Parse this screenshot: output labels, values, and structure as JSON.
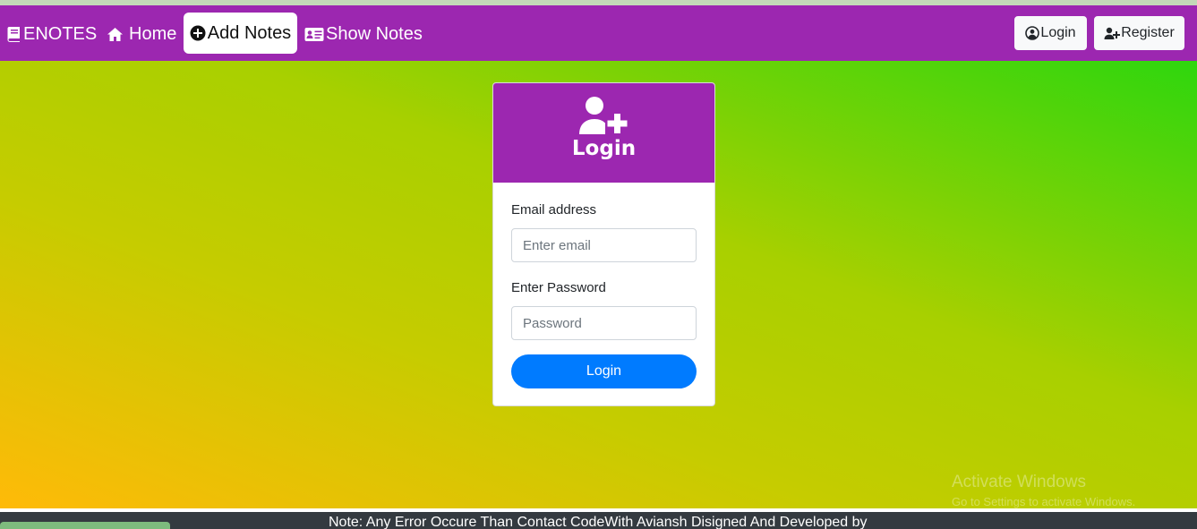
{
  "navbar": {
    "brand": "ENOTES",
    "links": {
      "home": "Home",
      "add_notes": "Add Notes",
      "show_notes": "Show Notes"
    },
    "buttons": {
      "login": "Login",
      "register": "Register"
    }
  },
  "login_card": {
    "title": "Login",
    "email_label": "Email address",
    "email_placeholder": "Enter email",
    "email_value": "",
    "password_label": "Enter Password",
    "password_placeholder": "Password",
    "password_value": "",
    "submit_label": "Login"
  },
  "footer": {
    "note": "Note: Any Error Occure Than Contact CodeWith Aviansh Disigned And Developed by"
  },
  "watermark": {
    "title": "Activate Windows",
    "subtitle": "Go to Settings to activate Windows."
  },
  "colors": {
    "navbar": "#9c27b0",
    "primary_button": "#007bff",
    "gradient_start": "#ffba08",
    "gradient_end": "#2ed60e",
    "footer": "#343a40"
  },
  "icons": {
    "brand": "book-icon",
    "home": "home-icon",
    "add_notes": "plus-circle-icon",
    "show_notes": "id-card-icon",
    "login": "user-circle-icon",
    "register": "user-plus-icon",
    "card_header": "user-plus-icon"
  }
}
